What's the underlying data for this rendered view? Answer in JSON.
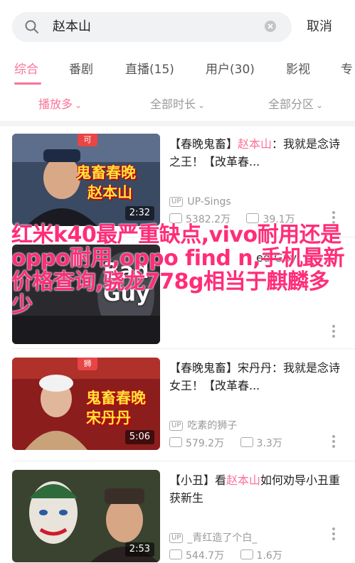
{
  "search": {
    "query": "赵本山",
    "cancel_label": "取消"
  },
  "tabs": [
    {
      "label": "综合",
      "active": true
    },
    {
      "label": "番剧"
    },
    {
      "label": "直播(15)"
    },
    {
      "label": "用户(30)"
    },
    {
      "label": "影视"
    },
    {
      "label": "专"
    }
  ],
  "filters": [
    {
      "label": "播放多",
      "active": true
    },
    {
      "label": "全部时长"
    },
    {
      "label": "全部分区"
    }
  ],
  "colors": {
    "accent": "#fb7299",
    "overlay_text": "#ff2d78"
  },
  "results": [
    {
      "title_prefix": "【春晚鬼畜】",
      "title_highlight": "赵本山",
      "title_suffix": "：我就是念诗之王！【改革春...",
      "uploader": "UP-Sings",
      "plays": "5382.2万",
      "danmaku": "39.1万",
      "duration": "2:32",
      "thumb_text_line1": "鬼畜春晚",
      "thumb_text_line2": "赵本山",
      "thumb_badge": "可"
    },
    {
      "title_prefix": "",
      "title_highlight": "",
      "title_suffix": "ed Guy",
      "uploader": "",
      "plays": "",
      "danmaku": "",
      "duration": "",
      "thumb_text_line1": "Bad",
      "thumb_text_line2": "Guy",
      "thumb_badge": ""
    },
    {
      "title_prefix": "【春晚鬼畜】宋丹丹：我就是念诗女王！【改革春...",
      "title_highlight": "",
      "title_suffix": "",
      "uploader": "吃素的狮子",
      "plays": "579.2万",
      "danmaku": "3.3万",
      "duration": "5:06",
      "thumb_text_line1": "鬼畜春晚",
      "thumb_text_line2": "宋丹丹",
      "thumb_badge": "狮"
    },
    {
      "title_prefix": "【小丑】看",
      "title_highlight": "赵本山",
      "title_suffix": "如何劝导小丑重获新生",
      "uploader": "_青红造了个白_",
      "plays": "544.7万",
      "danmaku": "1.6万",
      "duration": "2:53",
      "thumb_text_line1": "",
      "thumb_text_line2": "",
      "thumb_badge": ""
    }
  ],
  "overlay": {
    "text": "红米k40最严重缺点,vivo耐用还是oppo耐用,oppo find n,手机最新价格查询,骁龙778g相当于麒麟多少"
  },
  "icons": {
    "search": "search-icon",
    "clear": "clear-icon",
    "up": "up-tag-icon",
    "play": "play-count-icon",
    "danmaku": "danmaku-icon",
    "more": "more-vertical-icon"
  }
}
